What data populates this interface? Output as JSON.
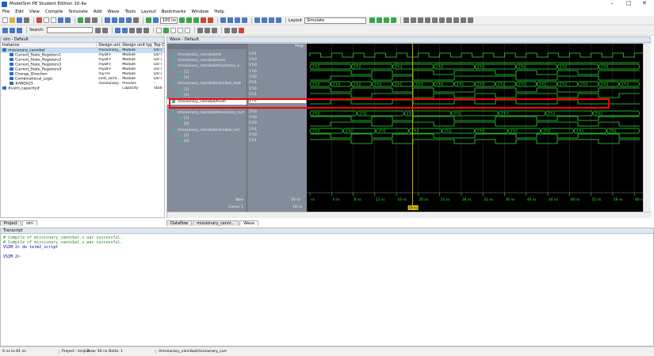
{
  "window": {
    "title": "ModelSim PE Student Edition 10.4a",
    "min": "–",
    "max": "□",
    "close": "✕"
  },
  "menu": [
    "File",
    "Edit",
    "View",
    "Compile",
    "Simulate",
    "Add",
    "Wave",
    "Tools",
    "Layout",
    "Bookmarks",
    "Window",
    "Help"
  ],
  "toolbar": {
    "run_length": "100 ns",
    "layout_label": "Layout",
    "layout_value": "Simulate",
    "search_label": "Search:"
  },
  "sim_pane": {
    "title": "sim - Default",
    "headers": [
      "Instance",
      "Design unit",
      "Design unit type",
      "Top Category"
    ],
    "rows": [
      {
        "name": "missionary_cannibal",
        "unit": "missionary_...",
        "type": "Module",
        "cat": "DU I",
        "sel": true,
        "indent": 0
      },
      {
        "name": "Current_State_Registers1",
        "unit": "myDFF",
        "type": "Module",
        "cat": "DU I",
        "indent": 1
      },
      {
        "name": "Current_State_Registers2",
        "unit": "myDFF",
        "type": "Module",
        "cat": "DU I",
        "indent": 1
      },
      {
        "name": "Current_State_Registers3",
        "unit": "myDFF",
        "type": "Module",
        "cat": "DU I",
        "indent": 1
      },
      {
        "name": "Current_State_Registers4",
        "unit": "myDFF",
        "type": "Module",
        "cat": "DU I",
        "indent": 1
      },
      {
        "name": "Change_Direction",
        "unit": "myTFF",
        "type": "Module",
        "cat": "DU I",
        "indent": 1
      },
      {
        "name": "Combinational_Logic",
        "unit": "First_Term...",
        "type": "Module",
        "cat": "DU I",
        "indent": 1
      },
      {
        "name": "#ANDA25",
        "unit": "missionary...",
        "type": "Process",
        "cat": "-",
        "indent": 1
      },
      {
        "name": "#vsim_capacity#",
        "unit": "",
        "type": "Capacity",
        "cat": "Stati",
        "indent": 0
      }
    ]
  },
  "wave_pane": {
    "title": "Wave - Default",
    "msgs_label": "Msgs",
    "signals": [
      {
        "name": "/missionary_cannibal/clk",
        "value": "1'h1"
      },
      {
        "name": "/missionary_cannibal/reset",
        "value": "1'h0"
      },
      {
        "name": "/missionary_cannibal/missionary_n...",
        "value": "2'h0"
      },
      {
        "name": "[1]",
        "value": "1'h0"
      },
      {
        "name": "[0]",
        "value": "1'h0"
      },
      {
        "name": "/missionary_cannibal/cannibal_next",
        "value": "2'h1"
      },
      {
        "name": "[1]",
        "value": "1'h0"
      },
      {
        "name": "[0]",
        "value": "1'h1"
      },
      {
        "name": "/missionary_cannibal/finish",
        "value": "1'h1"
      },
      {
        "name": "/missionary_cannibal/missionary_curr",
        "value": "2'h0"
      },
      {
        "name": "[1]",
        "value": "1'h0"
      },
      {
        "name": "[0]",
        "value": "1'h0"
      },
      {
        "name": "/missionary_cannibal/cannibal_curr",
        "value": "2'h1"
      },
      {
        "name": "[1]",
        "value": "1'h0"
      },
      {
        "name": "[0]",
        "value": "1'h1"
      }
    ],
    "now_label": "Now",
    "now_value": "50 ns",
    "cursor_label": "Cursor 1",
    "cursor_value": "19 ns",
    "cursor_marker": "19 ns",
    "time_ticks": [
      "ns",
      "4 ns",
      "8 ns",
      "12 ns",
      "16 ns",
      "20 ns",
      "24 ns",
      "28 ns",
      "32 ns",
      "36 ns",
      "40 ns",
      "44 ns",
      "48 ns",
      "52 ns",
      "56 ns",
      "60 ns"
    ],
    "bus_labels": {
      "missionary_next": [
        "2'h2",
        "2'h2",
        "2'h3",
        "2'h2",
        "2'h1",
        "2'h2",
        "2'h2",
        "2'h0"
      ],
      "cannibal_next": [
        "2'h3",
        "2'h2",
        "2'h2",
        "2'h3",
        "2'h2",
        "2'h3",
        "2'h2",
        "2'h1",
        "2'h3",
        "2'h2",
        "2'h3",
        "2'h2",
        "2'h1",
        "2'h3",
        "2'h2",
        "2'h3"
      ],
      "missionary_curr": [
        "2'h3",
        "2'h2",
        "2'h3",
        "2'h2",
        "2'h3",
        "2'h2",
        "2'h2"
      ],
      "cannibal_curr": [
        "2'h3",
        "2'h2",
        "2'h1",
        "2'h3",
        "2'h2",
        "2'h3",
        "2'h2",
        "2'h1",
        "2'h3",
        "2'h2"
      ]
    }
  },
  "tabs_left": [
    "Project",
    "sim"
  ],
  "tabs_right": [
    "Dataflow",
    "missionary_canni...",
    "Wave"
  ],
  "transcript": {
    "title": "Transcript",
    "lines": [
      "# Compile of missionary_cannibal.v was successful.",
      "# Compile of missionary_cannibal.v was successful.",
      "VSIM 2> do term2_script",
      "",
      "VSIM 2>"
    ]
  },
  "status": [
    "0 ns to 61 ns",
    "Project : term2",
    "Now: 50 ns  Delta: 1",
    "",
    "/missionary_cannibal/missionary_curr"
  ],
  "colors": {
    "highlight": "#ff0000",
    "wave": "#2ee02e",
    "cursor": "#e0c000",
    "canvas": "#000000"
  }
}
